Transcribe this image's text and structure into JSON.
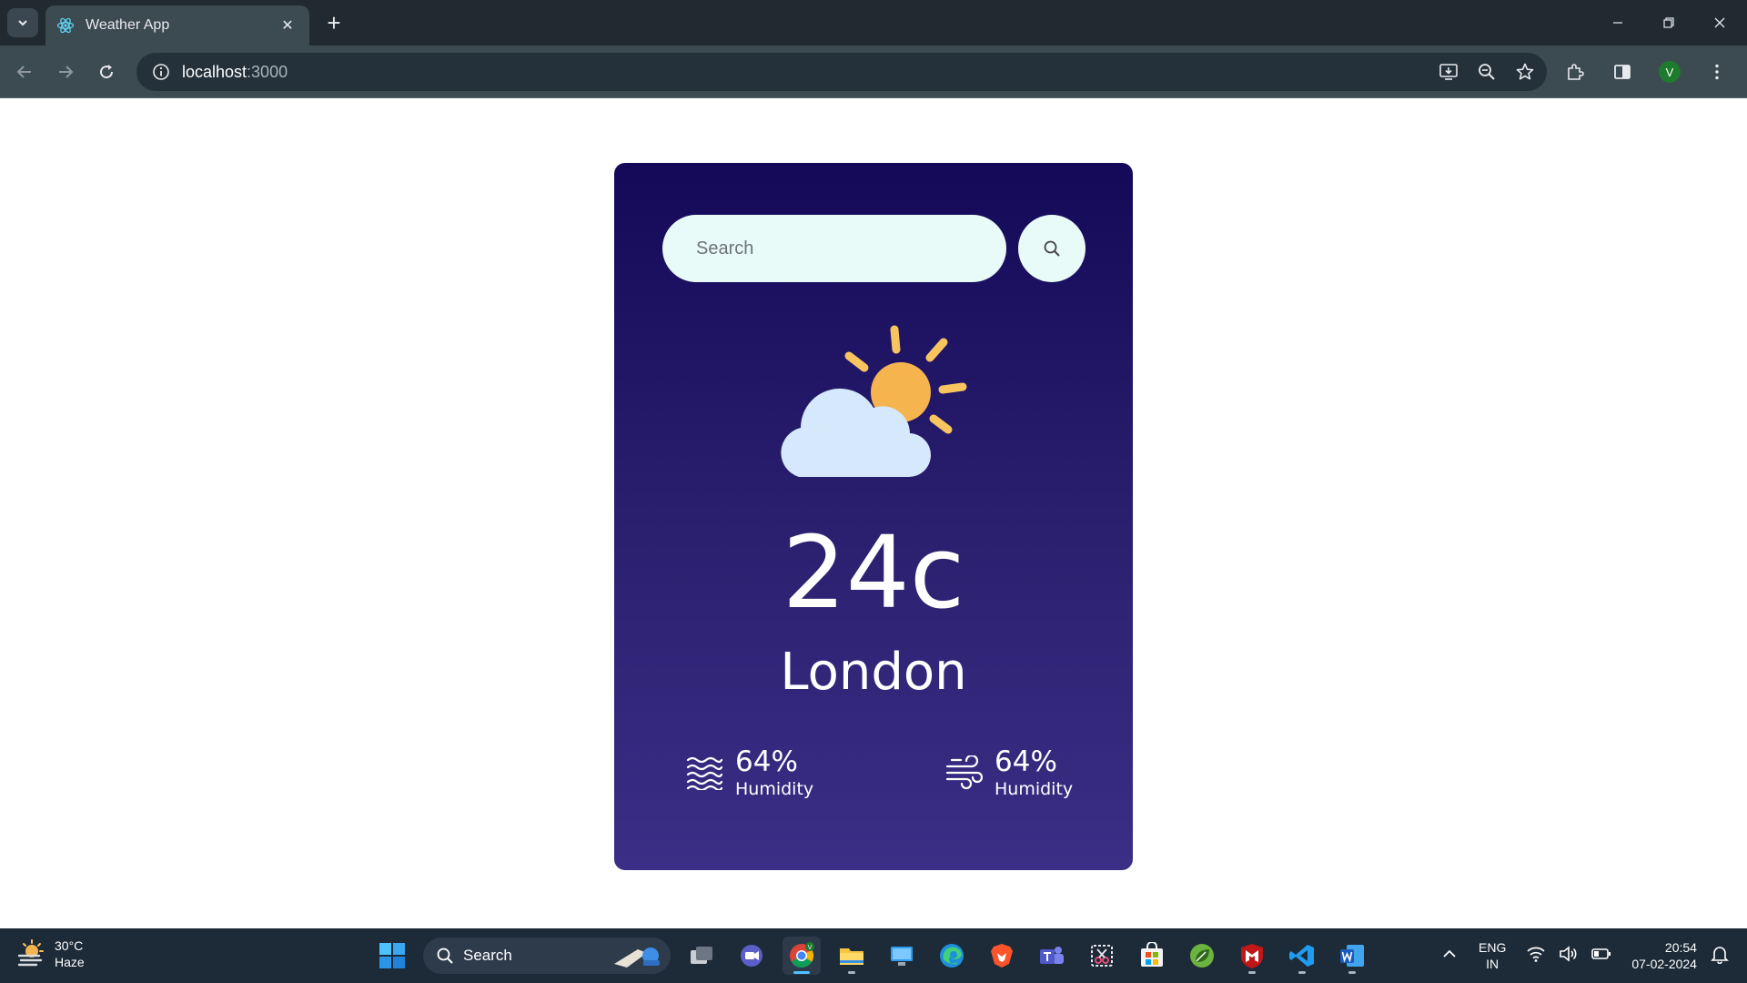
{
  "browser": {
    "tab_title": "Weather App",
    "url_host": "localhost",
    "url_port": ":3000",
    "profile_initial": "V"
  },
  "weather_app": {
    "search": {
      "placeholder": "Search"
    },
    "temperature": "24c",
    "city": "London",
    "humidity": {
      "value": "64%",
      "label": "Humidity"
    },
    "wind": {
      "value": "64%",
      "label": "Humidity"
    },
    "colors": {
      "card_top": "#140958",
      "card_bottom": "#3a2e86",
      "input_bg": "#e8fbf8",
      "sun": "#f6b44f",
      "sun_rays": "#f7c460",
      "cloud": "#d6e8fb"
    }
  },
  "taskbar": {
    "weather_temp": "30°C",
    "weather_desc": "Haze",
    "search_label": "Search",
    "apps": [
      "start-icon",
      "task-view-icon",
      "meet-icon",
      "chrome-icon",
      "file-explorer-icon",
      "remote-desktop-icon",
      "edge-icon",
      "brave-icon",
      "teams-icon",
      "snipping-tool-icon",
      "store-icon",
      "spring-icon",
      "mcafee-icon",
      "vscode-icon",
      "word-icon"
    ],
    "lang_top": "ENG",
    "lang_bottom": "IN",
    "time": "20:54",
    "date": "07-02-2024"
  }
}
